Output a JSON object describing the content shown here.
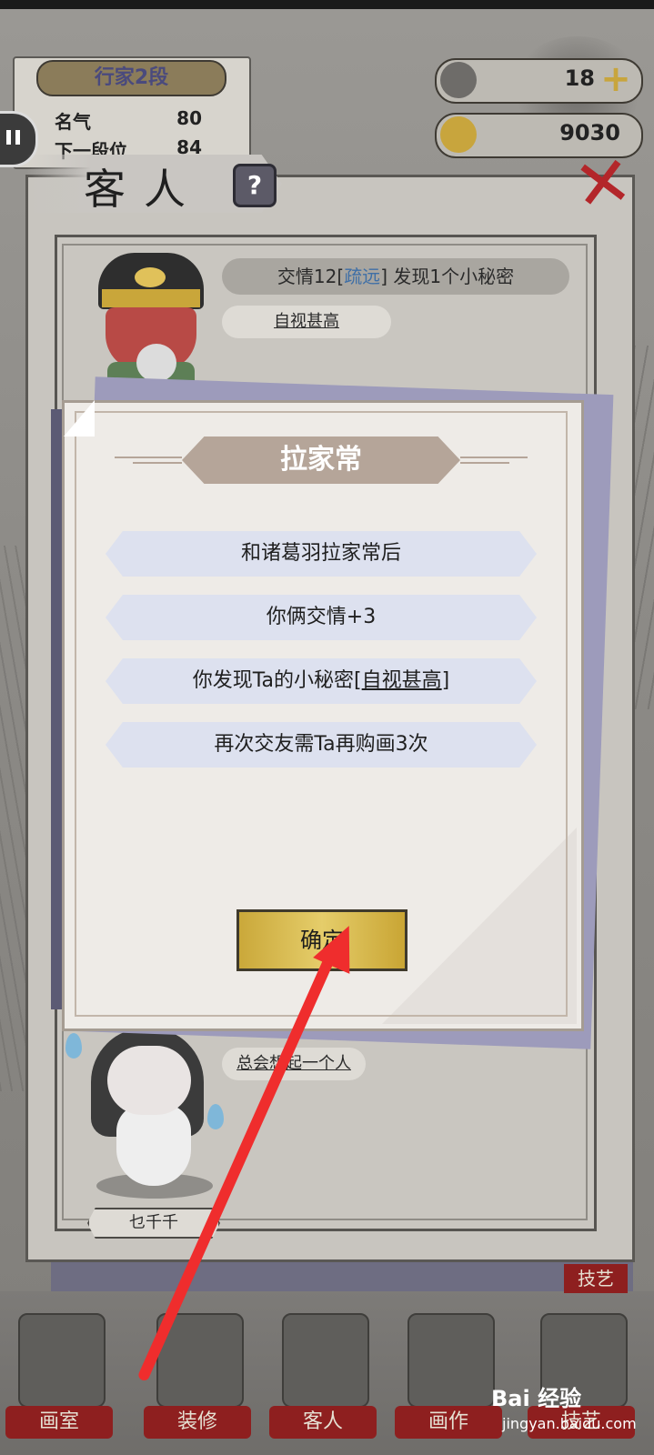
{
  "rank": {
    "title_prefix": "行家",
    "title_level": "2段",
    "reputation_label": "名气",
    "reputation_value": "80",
    "next_label": "下一段位",
    "next_value": "84"
  },
  "currency": {
    "ink_value": "18",
    "coin_value": "9030",
    "plus": "+"
  },
  "panel": {
    "title": "客人",
    "help": "?",
    "close": "✕"
  },
  "guest1": {
    "friendship_prefix": "交情12[",
    "friendship_status": "疏远",
    "friendship_suffix": "] 发现1个小秘密",
    "trait": "自视甚高"
  },
  "guest2": {
    "trait": "总会想起一个人",
    "name": "乜千千"
  },
  "dialog": {
    "title": "拉家常",
    "lines": [
      "和诸葛羽拉家常后",
      "你俩交情+3",
      "你发现Ta的小秘密[",
      "自视甚高",
      "]",
      "再次交友需Ta再购画3次"
    ],
    "confirm": "确定"
  },
  "nav": {
    "items": [
      "画室",
      "装修",
      "客人",
      "画作",
      "技艺"
    ],
    "skill_tag": "技艺"
  },
  "watermark": {
    "brand": "Bai 经验",
    "url": "jingyan.baidu.com"
  },
  "colors": {
    "accent_red": "#8e1f1f",
    "gold": "#d8bb4f",
    "arrow": "#ef2d2d"
  }
}
